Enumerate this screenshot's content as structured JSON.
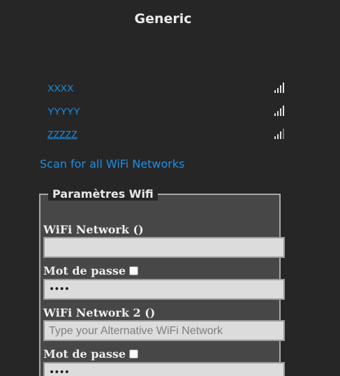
{
  "header": {
    "title": "Generic"
  },
  "networks": [
    {
      "name": "XXXX",
      "signal_bars": 4
    },
    {
      "name": "YYYYY",
      "signal_bars": 4
    },
    {
      "name": "ZZZZZ",
      "signal_bars": 3
    }
  ],
  "scan_link": "Scan for all WiFi Networks",
  "wifi_settings": {
    "legend": "Paramètres Wifi",
    "network1_label": "WiFi Network ()",
    "network1_value": "",
    "password1_label": "Mot de passe",
    "password1_value": "••••",
    "network2_label": "WiFi Network 2 ()",
    "network2_placeholder": "Type your Alternative WiFi Network",
    "password2_label": "Mot de passe",
    "password2_value": "••••"
  },
  "colors": {
    "background": "#262626",
    "link": "#1e90e6",
    "fieldset_bg": "#474747"
  }
}
